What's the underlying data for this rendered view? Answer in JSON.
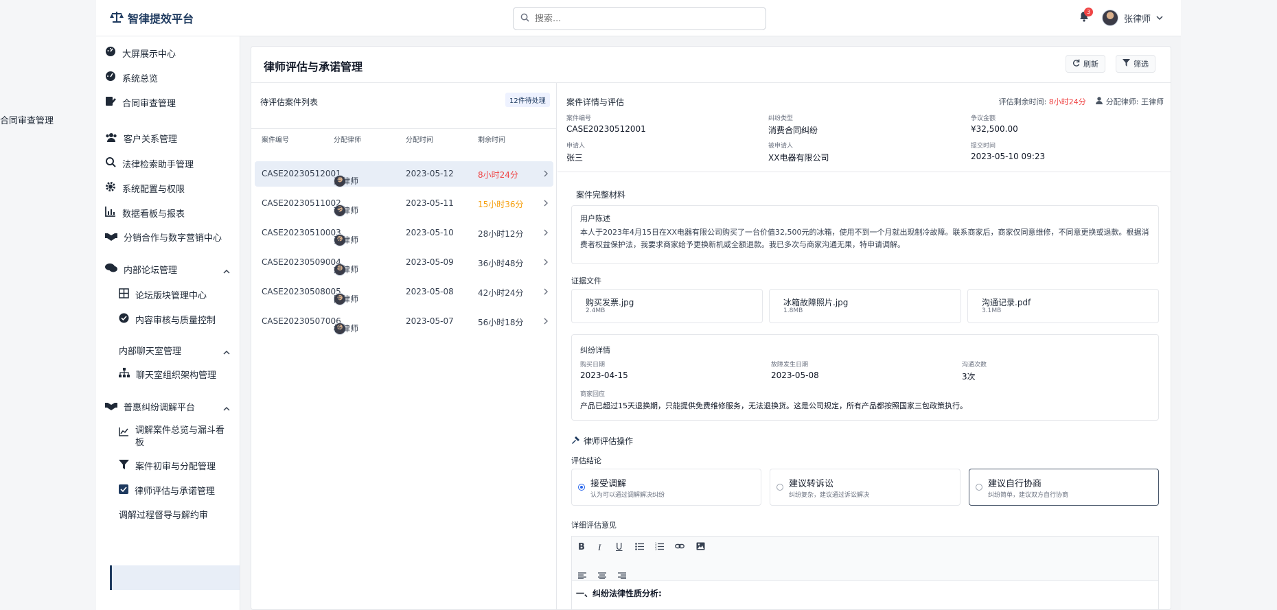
{
  "app": {
    "title": "智律提效平台"
  },
  "search": {
    "placeholder": "搜索..."
  },
  "header": {
    "notifications": "3",
    "user_name": "张律师"
  },
  "sidebar": {
    "items": [
      {
        "label": "大屏展示中心",
        "icon": "dashboard-icon"
      },
      {
        "label": "系统总览",
        "icon": "gauge-icon"
      },
      {
        "label": "合同审查管理",
        "icon": "contract-icon"
      },
      {
        "label": "客户关系管理",
        "icon": "users-icon"
      },
      {
        "label": "法律检索助手管理",
        "icon": "search-icon"
      },
      {
        "label": "系统配置与权限",
        "icon": "gear-icon"
      },
      {
        "label": "数据看板与报表",
        "icon": "bar-chart-icon"
      },
      {
        "label": "分销合作与数字营销中心",
        "icon": "handshake-icon"
      },
      {
        "label": "内部论坛管理",
        "icon": "comments-icon"
      },
      {
        "label": "论坛版块管理中心",
        "icon": "grid-icon"
      },
      {
        "label": "内容审核与质量控制",
        "icon": "check-circle-icon"
      },
      {
        "label": "内部聊天室管理",
        "icon": ""
      },
      {
        "label": "聊天室组织架构管理",
        "icon": "org-chart-icon"
      },
      {
        "label": "普惠纠纷调解平台",
        "icon": "handshake-icon"
      },
      {
        "label": "调解案件总览与漏斗看板",
        "icon": "line-chart-icon"
      },
      {
        "label": "案件初审与分配管理",
        "icon": "filter-icon"
      },
      {
        "label": "律师评估与承诺管理",
        "icon": "checkbox-icon"
      },
      {
        "label": "调解过程督导与解约审",
        "icon": ""
      }
    ],
    "tooltip": "合同审查管理"
  },
  "page": {
    "title": "律师评估与承诺管理",
    "refresh": "刷新",
    "filter": "筛选"
  },
  "list": {
    "title": "待评估案件列表",
    "pending": "12件待处理",
    "columns": [
      "案件编号",
      "分配律师",
      "分配时间",
      "剩余时间"
    ],
    "rows": [
      {
        "id": "CASE20230512001",
        "lawyer": "王律师",
        "date": "2023-05-12",
        "remain": "8小时24分",
        "status": "urgent"
      },
      {
        "id": "CASE20230511002",
        "lawyer": "李律师",
        "date": "2023-05-11",
        "remain": "15小时36分",
        "status": "warning"
      },
      {
        "id": "CASE20230510003",
        "lawyer": "张律师",
        "date": "2023-05-10",
        "remain": "28小时12分",
        "status": "normal"
      },
      {
        "id": "CASE20230509004",
        "lawyer": "刘律师",
        "date": "2023-05-09",
        "remain": "36小时48分",
        "status": "normal"
      },
      {
        "id": "CASE20230508005",
        "lawyer": "陈律师",
        "date": "2023-05-08",
        "remain": "42小时24分",
        "status": "normal"
      },
      {
        "id": "CASE20230507006",
        "lawyer": "杨律师",
        "date": "2023-05-07",
        "remain": "56小时18分",
        "status": "normal"
      }
    ]
  },
  "detail": {
    "title": "案件详情与评估",
    "remain_label": "评估剩余时间:",
    "remain_value": "8小时24分",
    "assigned_label": "分配律师: 王律师",
    "fields": [
      {
        "k": "案件编号",
        "v": "CASE20230512001"
      },
      {
        "k": "纠纷类型",
        "v": "消费合同纠纷"
      },
      {
        "k": "争议金额",
        "v": "¥32,500.00"
      },
      {
        "k": "申请人",
        "v": "张三"
      },
      {
        "k": "被申请人",
        "v": "XX电器有限公司"
      },
      {
        "k": "提交时间",
        "v": "2023-05-10 09:23"
      }
    ],
    "materials_title": "案件完整材料",
    "statement_title": "用户陈述",
    "statement": "本人于2023年4月15日在XX电器有限公司购买了一台价值32,500元的冰箱，使用不到一个月就出现制冷故障。联系商家后，商家仅同意维修，不同意更换或退款。根据消费者权益保护法，我要求商家给予更换新机或全额退款。我已多次与商家沟通无果，特申请调解。",
    "evidence_title": "证据文件",
    "files": [
      {
        "name": "购买发票.jpg",
        "size": "2.4MB"
      },
      {
        "name": "冰箱故障照片.jpg",
        "size": "1.8MB"
      },
      {
        "name": "沟通记录.pdf",
        "size": "3.1MB"
      }
    ],
    "dispute_title": "纠纷详情",
    "dispute": [
      {
        "k": "购买日期",
        "v": "2023-04-15"
      },
      {
        "k": "故障发生日期",
        "v": "2023-05-08"
      },
      {
        "k": "沟通次数",
        "v": "3次"
      }
    ],
    "merchant_label": "商家回应",
    "merchant_reply": "产品已超过15天退换期，只能提供免费维修服务，无法退换货。这是公司规定，所有产品都按照国家三包政策执行。",
    "eval_title": "律师评估操作",
    "conclusion_label": "评估结论",
    "options": [
      {
        "title": "接受调解",
        "desc": "认为可以通过调解解决纠纷"
      },
      {
        "title": "建议转诉讼",
        "desc": "纠纷复杂，建议通过诉讼解决"
      },
      {
        "title": "建议自行协商",
        "desc": "纠纷简单，建议双方自行协商"
      }
    ],
    "opinion_label": "详细评估意见",
    "editor_heading": "一、纠纷法律性质分析:"
  },
  "colors": {
    "accent": "#1e3a5f",
    "urgent": "#ef4444",
    "warning": "#f59e0b"
  }
}
